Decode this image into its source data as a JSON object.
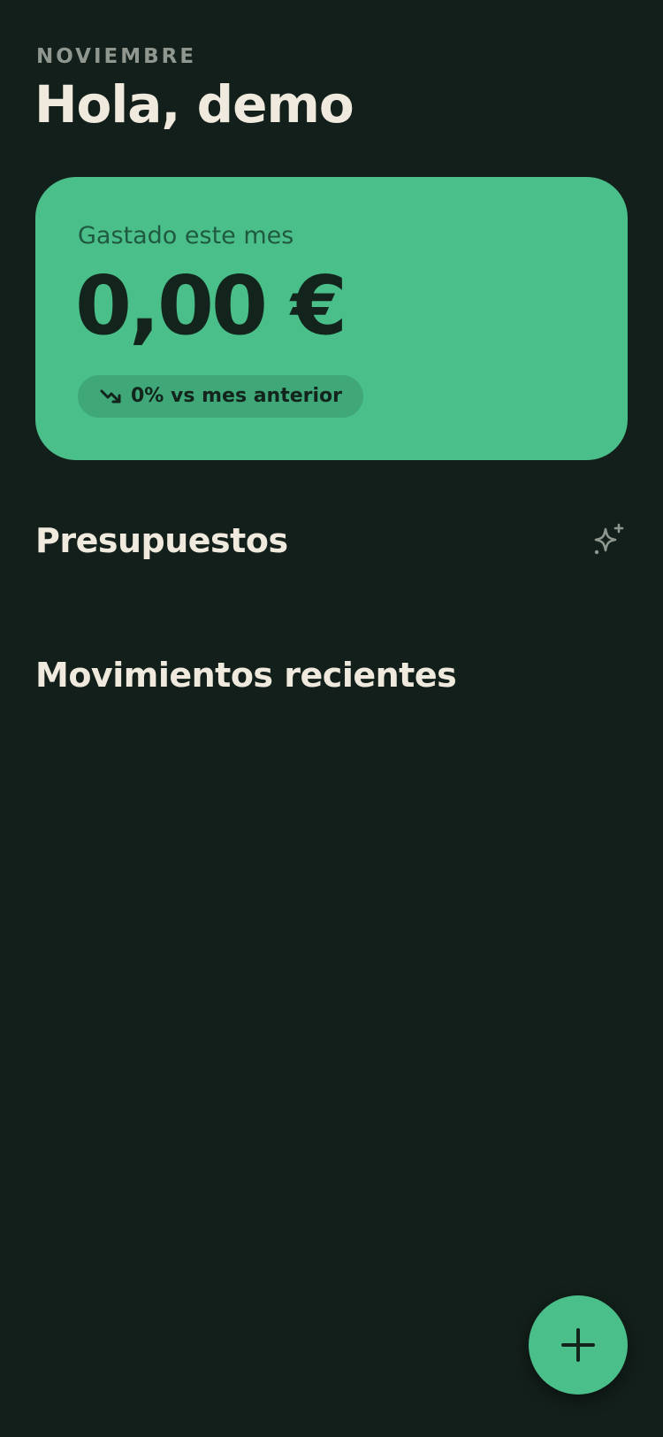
{
  "header": {
    "month": "NOVIEMBRE",
    "greeting": "Hola, demo"
  },
  "summary_card": {
    "label": "Gastado este mes",
    "amount": "0,00 €",
    "trend_text": "0% vs mes anterior",
    "trend_icon": "trending-down-icon"
  },
  "budgets": {
    "title": "Presupuestos",
    "action_icon": "sparkles-icon"
  },
  "recent": {
    "title": "Movimientos recientes"
  },
  "fab": {
    "icon": "plus-icon"
  },
  "colors": {
    "background": "#131f1a",
    "accent": "#4abf8a",
    "text_light": "#efeadd",
    "text_muted": "#8f978f"
  }
}
